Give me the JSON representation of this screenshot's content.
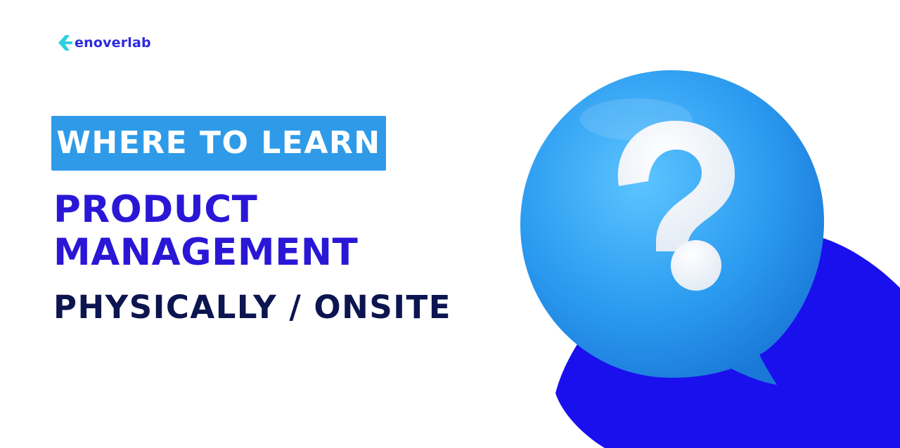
{
  "brand": {
    "name": "enoverlab",
    "icon": "chevron-arrow-left-icon",
    "text_color": "#2b2ae0",
    "icon_color": "#2ecfe0"
  },
  "tag": {
    "text": "WHERE TO LEARN",
    "background": "#2f9be8",
    "text_color": "#ffffff"
  },
  "headline": {
    "line1": "PRODUCT",
    "line2": "MANAGEMENT",
    "line3": "PHYSICALLY / ONSITE",
    "primary_color": "#2a17d6",
    "secondary_color": "#0d1550"
  },
  "illustration": {
    "icon": "question-mark-speech-bubble-icon",
    "bubble_color": "#2b9bf0",
    "backdrop_color": "#1a10ee",
    "glyph_color": "#ffffff"
  }
}
